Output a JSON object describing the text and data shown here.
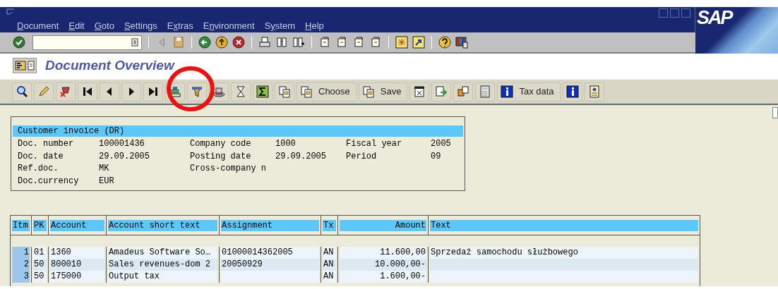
{
  "logo": "SAP",
  "menu": [
    {
      "key": "D",
      "post": "ocument"
    },
    {
      "key": "E",
      "post": "dit"
    },
    {
      "key": "G",
      "post": "oto"
    },
    {
      "key": "S",
      "post": "ettings"
    },
    {
      "pre": "E",
      "key": "x",
      "post": "tras"
    },
    {
      "pre": "E",
      "key": "n",
      "post": "vironment"
    },
    {
      "pre": "S",
      "key": "y",
      "post": "stem"
    },
    {
      "key": "H",
      "post": "elp"
    }
  ],
  "screen_title": "Document Overview",
  "application_toolbar": [
    {
      "label": "Choose"
    },
    {
      "label": "Save"
    },
    {
      "label": "Tax data"
    }
  ],
  "document_header": {
    "title": "Customer invoice (DR)",
    "rows": [
      [
        "Doc. number",
        "100001436",
        "Company code",
        "1000",
        "Fiscal year",
        "2005"
      ],
      [
        "Doc. date",
        "29.09.2005",
        "Posting date",
        "29.09.2005",
        "Period",
        "09"
      ],
      [
        "Ref.doc.",
        "MK",
        "Cross-company n",
        "",
        "",
        ""
      ],
      [
        "Doc.currency",
        "EUR",
        "",
        "",
        "",
        ""
      ]
    ]
  },
  "table": {
    "columns": [
      "Itm",
      "PK",
      "Account",
      "Account short text",
      "Assignment",
      "Tx",
      "Amount",
      "Text"
    ],
    "rows": [
      [
        "1",
        "01",
        "1360",
        "Amadeus Software So…",
        "01000014362005",
        "AN",
        "11.600,00",
        "Sprzedaż samochodu służbowego"
      ],
      [
        "2",
        "50",
        "800010",
        "Sales revenues-dom 2",
        "20050929",
        "AN",
        "10.000,00-",
        ""
      ],
      [
        "3",
        "50",
        "175000",
        "Output tax",
        "",
        "AN",
        "1.600,00-",
        ""
      ]
    ]
  }
}
